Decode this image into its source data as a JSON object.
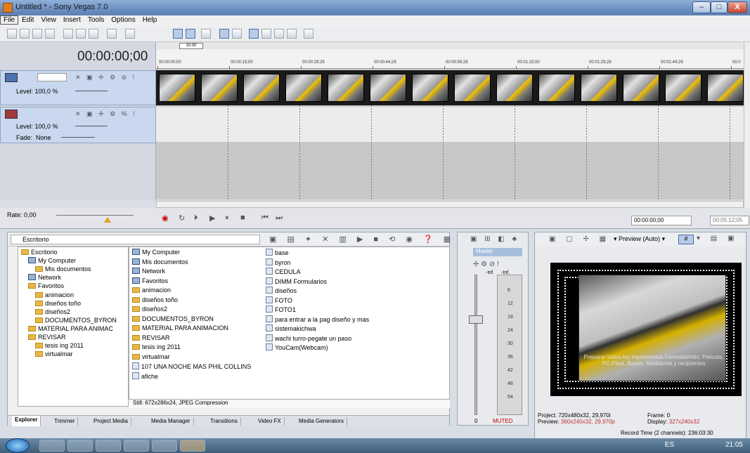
{
  "window": {
    "title": "Untitled * - Sony Vegas 7.0",
    "min": "–",
    "max": "□",
    "close": "X"
  },
  "menu": [
    "File",
    "Edit",
    "View",
    "Insert",
    "Tools",
    "Options",
    "Help"
  ],
  "timeline": {
    "timecode": "00:00:00;00",
    "loop_marker": "15:00",
    "ruler_ticks": [
      "00:00:00;00",
      "00:00:15;00",
      "00:00:29;29",
      "00:00:44;29",
      "00:00:59;28",
      "00:01:15;00",
      "00:01:29;29",
      "00:01:44;29",
      "00:0"
    ],
    "track1": {
      "level": "Level: 100,0 %"
    },
    "track2": {
      "level": "Level: 100,0 %",
      "fade_label": "Fade:",
      "fade_value": "None"
    },
    "rate": "Rate: 0,00",
    "cursor_time": "00:00:00;00",
    "end_time": "00:05:12;05"
  },
  "explorer": {
    "path": "Escritorio",
    "tree": [
      "Escritorio",
      "My Computer",
      "Mis documentos",
      "Network",
      "Favoritos",
      "animacion",
      "diseños toño",
      "diseños2",
      "DOCUMENTOS_BYRON",
      "MATERIAL PARA ANIMAC",
      "REVISAR",
      "tesis ing 2011",
      "virtualmar"
    ],
    "files_col1": [
      "My Computer",
      "Mis documentos",
      "Network",
      "Favoritos",
      "animacion",
      "diseños toño",
      "diseños2",
      "DOCUMENTOS_BYRON",
      "MATERIAL PARA ANIMACION",
      "REVISAR",
      "tesis ing 2011",
      "virtualmar",
      "107 UNA NOCHE MAS PHIL COLLINS",
      "afiche"
    ],
    "files_col2": [
      "base",
      "byron",
      "CEDULA",
      "DIMM Formularios",
      "diseños",
      "FOTO",
      "FOTO1",
      "para entrar a la pag diseño y mas",
      "sistemakichwa",
      "wachi turro-pegate un paso",
      "YouCam(Webcam)"
    ],
    "status": "Still: 672x286x24, JPEG Compression",
    "tabs": [
      "Explorer",
      "Trimmer",
      "Project Media",
      "Media Manager",
      "Transitions",
      "Video FX",
      "Media Generators"
    ]
  },
  "mixer": {
    "master": "Master",
    "inf1": "-Inf.",
    "inf2": "-Inf.",
    "scale": [
      "6",
      "12",
      "18",
      "24",
      "30",
      "36",
      "42",
      "48",
      "54"
    ],
    "muted": "MUTED",
    "zero": "0"
  },
  "preview": {
    "mode": "Preview (Auto)",
    "caption": "Preparar todos los implementos Formaldehido, Pelicula, PC-Plast, Bases, Medidores y recipientes",
    "project_label": "Project:",
    "project_value": "720x480x32, 29,970i",
    "preview_label": "Preview:",
    "preview_value": "360x240x32, 29,970p",
    "frame_label": "Frame:",
    "frame_value": "0",
    "display_label": "Display:",
    "display_value": "327x240x32",
    "record_time": "Record Time (2 channels): 236:03:30"
  },
  "taskbar": {
    "lang": "ES",
    "clock": "21:05"
  }
}
